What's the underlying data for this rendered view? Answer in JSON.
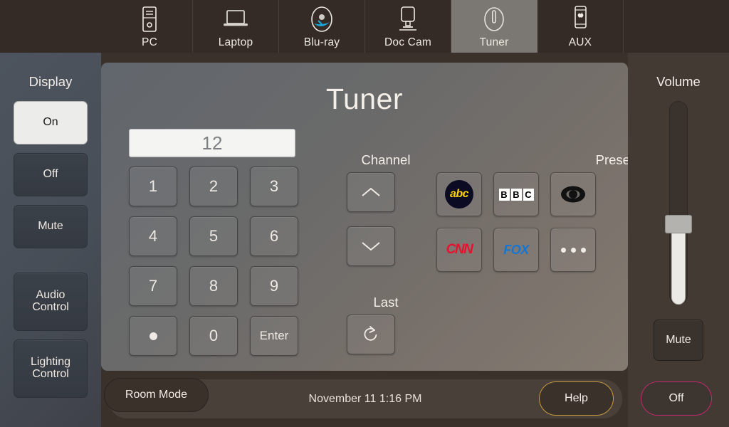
{
  "sources": {
    "tabs": [
      {
        "label": "PC",
        "icon": "desktop-tower-icon",
        "active": false
      },
      {
        "label": "Laptop",
        "icon": "laptop-icon",
        "active": false
      },
      {
        "label": "Blu-ray",
        "icon": "bluray-disc-icon",
        "active": false
      },
      {
        "label": "Doc Cam",
        "icon": "document-camera-icon",
        "active": false
      },
      {
        "label": "Tuner",
        "icon": "tuner-knob-icon",
        "active": true
      },
      {
        "label": "AUX",
        "icon": "phone-apple-icon",
        "active": false
      }
    ]
  },
  "sidebar": {
    "title": "Display",
    "items": [
      {
        "label": "On",
        "active": true
      },
      {
        "label": "Off",
        "active": false
      },
      {
        "label": "Mute",
        "active": false
      }
    ],
    "extras": [
      {
        "label": "Audio\nControl",
        "line1": "Audio",
        "line2": "Control"
      },
      {
        "label": "Lighting\nControl",
        "line1": "Lighting",
        "line2": "Control"
      }
    ]
  },
  "main": {
    "title": "Tuner",
    "readout_value": "12",
    "keypad": [
      {
        "label": "1",
        "name": "key-1"
      },
      {
        "label": "2",
        "name": "key-2"
      },
      {
        "label": "3",
        "name": "key-3"
      },
      {
        "label": "4",
        "name": "key-4"
      },
      {
        "label": "5",
        "name": "key-5"
      },
      {
        "label": "6",
        "name": "key-6"
      },
      {
        "label": "7",
        "name": "key-7"
      },
      {
        "label": "8",
        "name": "key-8"
      },
      {
        "label": "9",
        "name": "key-9"
      },
      {
        "label": "",
        "name": "key-dot",
        "icon": "dot-icon"
      },
      {
        "label": "0",
        "name": "key-0"
      },
      {
        "label": "Enter",
        "name": "key-enter"
      }
    ],
    "channel": {
      "label": "Channel",
      "up_icon": "chevron-up-icon",
      "down_icon": "chevron-down-icon"
    },
    "presets": {
      "label": "Presets",
      "items": [
        {
          "name": "preset-abc",
          "logo": "abc",
          "text": "abc"
        },
        {
          "name": "preset-bbc",
          "logo": "bbc",
          "text": "BBC"
        },
        {
          "name": "preset-cbs",
          "logo": "cbs",
          "text": "CBS"
        },
        {
          "name": "preset-cnn",
          "logo": "cnn",
          "text": "CNN"
        },
        {
          "name": "preset-fox",
          "logo": "fox",
          "text": "FOX"
        },
        {
          "name": "preset-more",
          "logo": "more",
          "text": "..."
        }
      ]
    },
    "last": {
      "label": "Last",
      "icon": "counter-clockwise-arrow-icon"
    }
  },
  "volume": {
    "title": "Volume",
    "mute_label": "Mute",
    "level_percent": 38
  },
  "bottom": {
    "room_mode_label": "Room Mode",
    "datetime": "November 11 1:16 PM",
    "help_label": "Help",
    "off_label": "Off"
  },
  "colors": {
    "topbar": "#342b26",
    "sidebar": "#4a515b",
    "accent_help": "#c79b3e",
    "accent_off": "#c2276e",
    "abc_yellow": "#ffd400",
    "cnn_red": "#e8112d",
    "fox_blue": "#1277d4"
  }
}
